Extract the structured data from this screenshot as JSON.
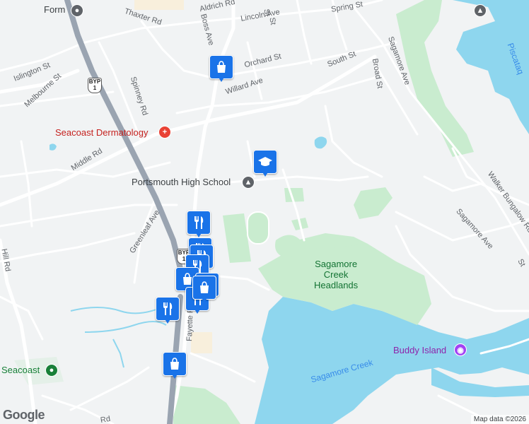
{
  "map": {
    "attribution": "Map data ©2026",
    "logo": "Google",
    "colors": {
      "land": "#f1f3f4",
      "water": "#8ed6ee",
      "park": "#c9eccf",
      "park_dark": "#a8dcb4",
      "road": "#ffffff",
      "highway": "#9aa4b1",
      "pin": "#1a73e8"
    }
  },
  "streets": [
    "Aldrich Rd",
    "Thaxter Rd",
    "Lincoln Ave",
    "Spring St",
    "Boss Ave",
    "Islington St",
    "Melbourne St",
    "Orchard St",
    "South St",
    "Sagamore Ave",
    "Broad St",
    "Willard Ave",
    "Spinney Rd",
    "Middle Rd",
    "Greenleaf Ave",
    "Fayette Rd",
    "Walker Bungalow Rd",
    "Sagamore Ave",
    "Hill Rd",
    "St",
    "St",
    "Rd",
    "St"
  ],
  "places": {
    "form": "Form",
    "dermatology": "Seacoast Dermatology",
    "high_school": "Portsmouth High School",
    "headlands": "Sagamore\nCreek\nHeadlands",
    "buddy_island": "Buddy Island",
    "seacoast": "Seacoast",
    "creek": "Sagamore Creek",
    "river": "Piscataq"
  },
  "shields": [
    "BYP\n1",
    "BYP\n1"
  ],
  "pins": [
    {
      "type": "shopping",
      "icon": "shopping-bag-icon"
    },
    {
      "type": "school",
      "icon": "graduation-cap-icon"
    },
    {
      "type": "restaurant",
      "icon": "fork-knife-icon"
    },
    {
      "type": "restaurant",
      "icon": "fork-knife-icon"
    },
    {
      "type": "restaurant",
      "icon": "fork-knife-icon"
    },
    {
      "type": "restaurant",
      "icon": "fork-knife-icon"
    },
    {
      "type": "shopping",
      "icon": "shopping-bag-icon"
    },
    {
      "type": "restaurant",
      "icon": "fork-knife-icon"
    },
    {
      "type": "restaurant",
      "icon": "fork-knife-icon"
    },
    {
      "type": "shopping",
      "icon": "shopping-bag-icon"
    },
    {
      "type": "restaurant",
      "icon": "fork-knife-icon"
    },
    {
      "type": "shopping",
      "icon": "shopping-bag-icon"
    }
  ]
}
